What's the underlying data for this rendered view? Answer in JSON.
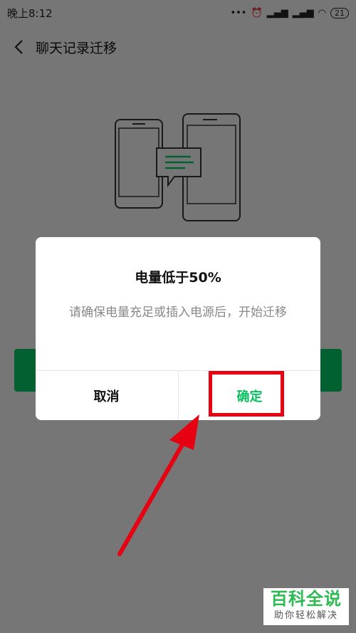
{
  "status": {
    "time": "晚上8:12",
    "battery": "21"
  },
  "nav": {
    "title": "聊天记录迁移"
  },
  "dialog": {
    "title": "电量低于50%",
    "message": "请确保电量充足或插入电源后，开始迁移",
    "cancel_label": "取消",
    "confirm_label": "确定"
  },
  "watermark": {
    "title": "百科全说",
    "subtitle": "助你轻松解决"
  },
  "colors": {
    "accent": "#07c160",
    "highlight": "#e60012",
    "bg": "#ededed"
  }
}
